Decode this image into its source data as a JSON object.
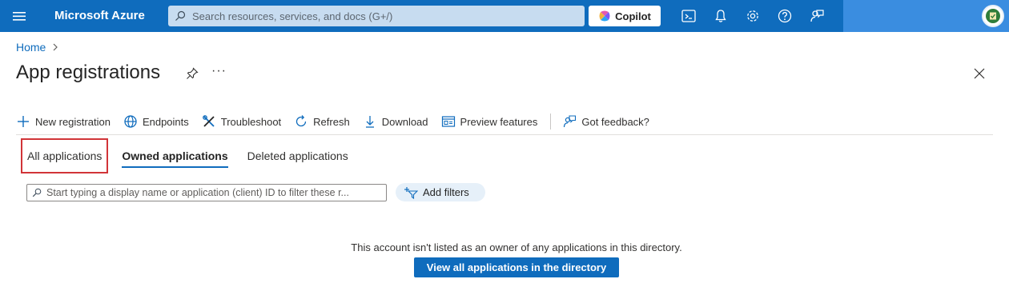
{
  "topbar": {
    "brand": "Microsoft Azure",
    "search_placeholder": "Search resources, services, and docs (G+/)",
    "copilot_label": "Copilot",
    "icons": [
      "cloud-shell-icon",
      "notifications-icon",
      "settings-icon",
      "help-icon",
      "feedback-icon"
    ]
  },
  "breadcrumb": {
    "home": "Home"
  },
  "page": {
    "title": "App registrations",
    "more": "···"
  },
  "toolbar": {
    "new_registration": "New registration",
    "endpoints": "Endpoints",
    "troubleshoot": "Troubleshoot",
    "refresh": "Refresh",
    "download": "Download",
    "preview_features": "Preview features",
    "feedback": "Got feedback?"
  },
  "tabs": {
    "all": "All applications",
    "owned": "Owned applications",
    "deleted": "Deleted applications"
  },
  "filter": {
    "placeholder": "Start typing a display name or application (client) ID to filter these r...",
    "add_filters": "Add filters"
  },
  "empty": {
    "message": "This account isn't listed as an owner of any applications in this directory.",
    "view_all": "View all applications in the directory"
  },
  "colors": {
    "brand_blue": "#0f6cbd",
    "highlight_red": "#d13438"
  }
}
